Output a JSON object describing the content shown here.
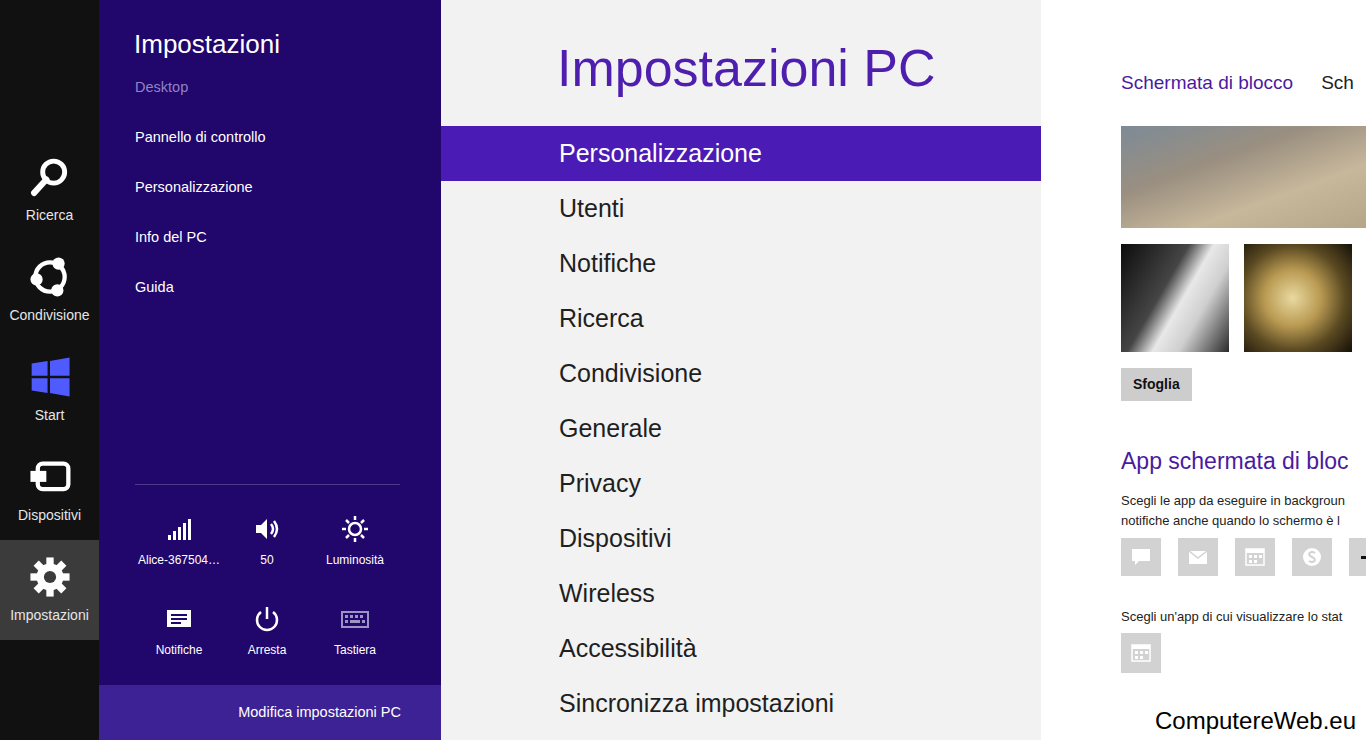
{
  "charms": [
    {
      "label": "Ricerca",
      "selected": false
    },
    {
      "label": "Condivisione",
      "selected": false
    },
    {
      "label": "Start",
      "selected": false
    },
    {
      "label": "Dispositivi",
      "selected": false
    },
    {
      "label": "Impostazioni",
      "selected": true
    }
  ],
  "settings_pane": {
    "title": "Impostazioni",
    "context": "Desktop",
    "links": [
      "Pannello di controllo",
      "Personalizzazione",
      "Info del PC",
      "Guida"
    ],
    "quick": [
      {
        "label": "Alice-367504…"
      },
      {
        "label": "50"
      },
      {
        "label": "Luminosità"
      },
      {
        "label": "Notifiche"
      },
      {
        "label": "Arresta"
      },
      {
        "label": "Tastiera"
      }
    ],
    "footer": "Modifica impostazioni PC"
  },
  "pc_settings": {
    "title": "Impostazioni PC",
    "items": [
      {
        "label": "Personalizzazione",
        "selected": true
      },
      {
        "label": "Utenti",
        "selected": false
      },
      {
        "label": "Notifiche",
        "selected": false
      },
      {
        "label": "Ricerca",
        "selected": false
      },
      {
        "label": "Condivisione",
        "selected": false
      },
      {
        "label": "Generale",
        "selected": false
      },
      {
        "label": "Privacy",
        "selected": false
      },
      {
        "label": "Dispositivi",
        "selected": false
      },
      {
        "label": "Wireless",
        "selected": false
      },
      {
        "label": "Accessibilità",
        "selected": false
      },
      {
        "label": "Sincronizza impostazioni",
        "selected": false
      }
    ]
  },
  "content": {
    "tabs": [
      {
        "label": "Schermata di blocco",
        "selected": true
      },
      {
        "label": "Sch",
        "selected": false
      }
    ],
    "browse_button": "Sfoglia",
    "apps_heading": "App schermata di bloc",
    "apps_description": [
      "Scegli le app da eseguire in backgroun",
      "notifiche anche quando lo schermo è l"
    ],
    "detail_description": "Scegli un'app di cui visualizzare lo stat"
  },
  "watermark": "ComputereWeb.eu"
}
